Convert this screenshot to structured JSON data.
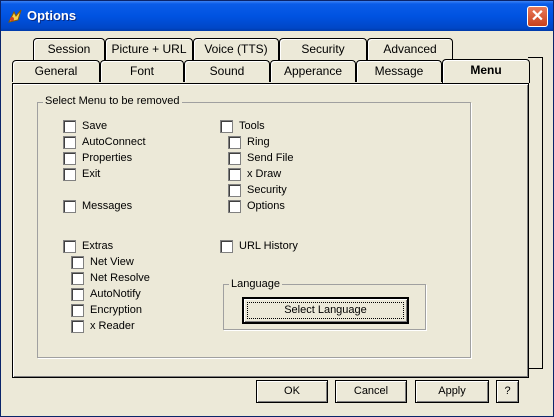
{
  "window": {
    "title": "Options",
    "close_label": "✕"
  },
  "tabs_back": [
    {
      "label": "Session"
    },
    {
      "label": "Picture + URL"
    },
    {
      "label": "Voice (TTS)"
    },
    {
      "label": "Security"
    },
    {
      "label": "Advanced"
    }
  ],
  "tabs_front": [
    {
      "label": "General"
    },
    {
      "label": "Font"
    },
    {
      "label": "Sound"
    },
    {
      "label": "Apperance"
    },
    {
      "label": "Message"
    },
    {
      "label": "Menu",
      "active": true
    }
  ],
  "menu_group": {
    "label": "Select Menu to be removed",
    "left_items": [
      {
        "label": "Save",
        "checked": false
      },
      {
        "label": "AutoConnect",
        "checked": false
      },
      {
        "label": "Properties",
        "checked": false
      },
      {
        "label": "Exit",
        "checked": false
      },
      {
        "label": "Messages",
        "checked": false
      },
      {
        "label": "Extras",
        "checked": false
      }
    ],
    "extras_items": [
      {
        "label": "Net View",
        "checked": false
      },
      {
        "label": "Net Resolve",
        "checked": false
      },
      {
        "label": "AutoNotify",
        "checked": false
      },
      {
        "label": "Encryption",
        "checked": false
      },
      {
        "label": "x Reader",
        "checked": false
      }
    ],
    "tools": {
      "label": "Tools",
      "checked": false
    },
    "tools_items": [
      {
        "label": "Ring",
        "checked": false
      },
      {
        "label": "Send File",
        "checked": false
      },
      {
        "label": "x Draw",
        "checked": false
      },
      {
        "label": "Security",
        "checked": false
      },
      {
        "label": "Options",
        "checked": false
      }
    ],
    "url_history": {
      "label": "URL History",
      "checked": false
    }
  },
  "language_group": {
    "label": "Language",
    "button_label": "Select Language"
  },
  "footer": {
    "ok_label": "OK",
    "cancel_label": "Cancel",
    "apply_label": "Apply",
    "help_label": "?"
  }
}
